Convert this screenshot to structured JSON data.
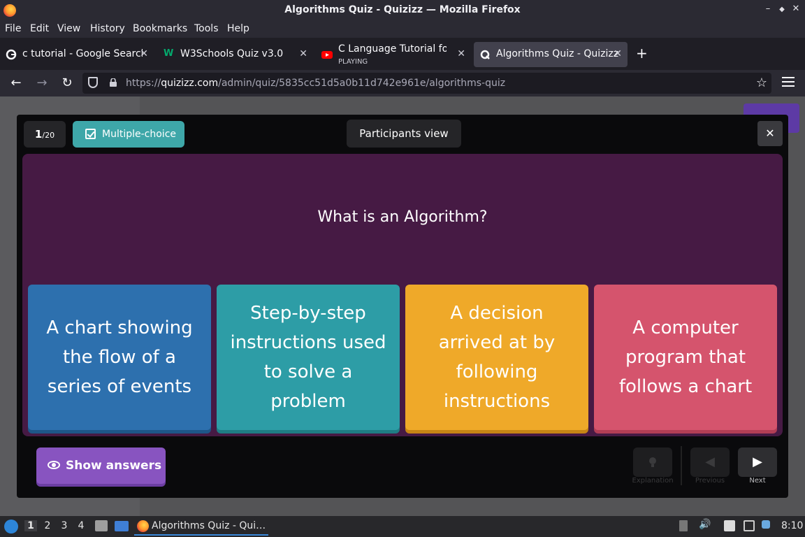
{
  "window": {
    "title": "Algorithms Quiz - Quizizz — Mozilla Firefox",
    "minimize": "–",
    "maximize": "◆",
    "close": "✕"
  },
  "menu": {
    "items": [
      "File",
      "Edit",
      "View",
      "History",
      "Bookmarks",
      "Tools",
      "Help"
    ]
  },
  "tabs": [
    {
      "label": "c tutorial - Google Search",
      "favicon": "google-icon"
    },
    {
      "label": "W3Schools Quiz v3.0",
      "favicon": "w3schools-icon"
    },
    {
      "label": "C Language Tutorial for B",
      "sub": "PLAYING",
      "favicon": "youtube-icon"
    },
    {
      "label": "Algorithms Quiz - Quizizz",
      "favicon": "quizizz-icon",
      "active": true
    }
  ],
  "nav": {
    "url_prefix": "https://",
    "url_domain": "quizizz.com",
    "url_path": "/admin/quiz/5835cc51d5a0b11d742e961e/algorithms-quiz"
  },
  "modal": {
    "question_number": "1",
    "question_total": "/20",
    "question_type": "Multiple-choice",
    "participants_view": "Participants view",
    "close": "✕",
    "question": "What is an Algorithm?",
    "options": [
      {
        "text": "A chart showing the flow of a series of events",
        "color": "#2d70ae"
      },
      {
        "text": "Step-by-step instructions used to solve a problem",
        "color": "#2d9da6"
      },
      {
        "text": "A decision arrived at by following instructions",
        "color": "#efa929"
      },
      {
        "text": "A computer program that follows a chart",
        "color": "#d5546d"
      }
    ],
    "show_answers": "Show answers",
    "controls": {
      "explanation": "Explanation",
      "previous": "Previous",
      "next": "Next"
    }
  },
  "taskbar": {
    "workspaces": [
      "1",
      "2",
      "3",
      "4"
    ],
    "task": "Algorithms Quiz - Qui…",
    "clock": "8:10"
  },
  "colors": {
    "accent_purple": "#8854c0",
    "question_panel": "#461a44",
    "type_badge": "#3ea7a9"
  }
}
